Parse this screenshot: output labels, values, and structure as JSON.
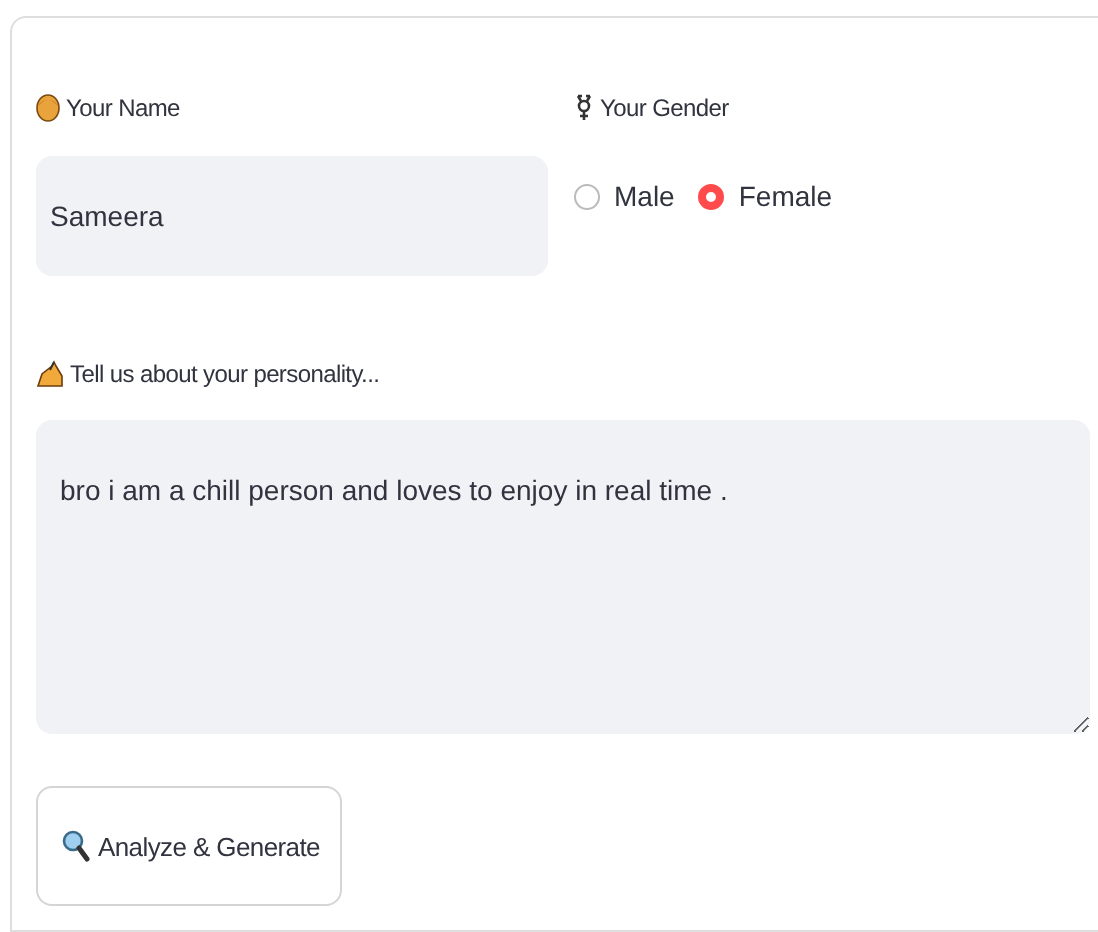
{
  "name_field": {
    "label": "Your Name",
    "value": "Sameera"
  },
  "gender": {
    "label": "Your Gender",
    "options": [
      {
        "label": "Male",
        "selected": false
      },
      {
        "label": "Female",
        "selected": true
      }
    ]
  },
  "personality": {
    "label": "Tell us about your personality...",
    "value": "bro i am a chill person and loves to enjoy in real time ."
  },
  "button": {
    "label": "Analyze & Generate"
  }
}
